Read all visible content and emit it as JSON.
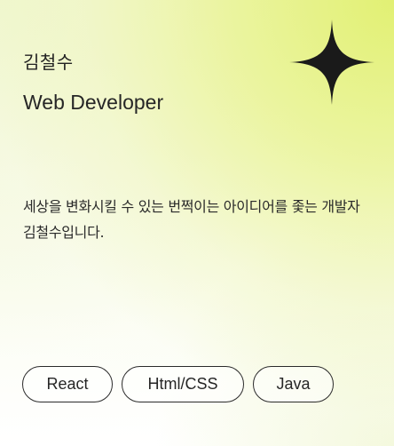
{
  "profile": {
    "name": "김철수",
    "role": "Web Developer",
    "description": "세상을 변화시킬 수 있는  번쩍이는 아이디어를 좇는 개발자 김철수입니다."
  },
  "icons": {
    "decoration": "sparkle-icon"
  },
  "skills": [
    "React",
    "Html/CSS",
    "Java"
  ],
  "colors": {
    "text": "#262626",
    "border": "#2b2b2b",
    "sparkle": "#1a1a1a",
    "gradient_accent": "#e1f06e"
  }
}
